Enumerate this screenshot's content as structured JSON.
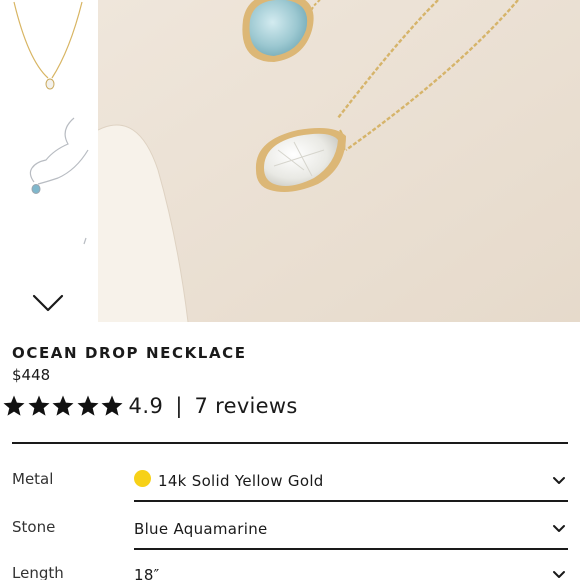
{
  "product": {
    "title": "OCEAN DROP NECKLACE",
    "price": "$448",
    "rating": "4.9",
    "rating_stars": 5,
    "reviews": "7 reviews",
    "separator": "|"
  },
  "options": {
    "metal": {
      "label": "Metal",
      "value": "14k Solid Yellow Gold",
      "swatch_color": "#f7d117"
    },
    "stone": {
      "label": "Stone",
      "value": "Blue Aquamarine"
    },
    "length": {
      "label": "Length",
      "value": "18″"
    }
  },
  "gallery": {
    "thumbnails": [
      "thumbnail-gold-clear",
      "thumbnail-silver-aquamarine",
      "thumbnail-partial"
    ],
    "next_icon": "chevron-down-icon"
  },
  "colors": {
    "background": "#ffffff",
    "text": "#1a1a1a",
    "hero_background": "#ece2d5"
  }
}
